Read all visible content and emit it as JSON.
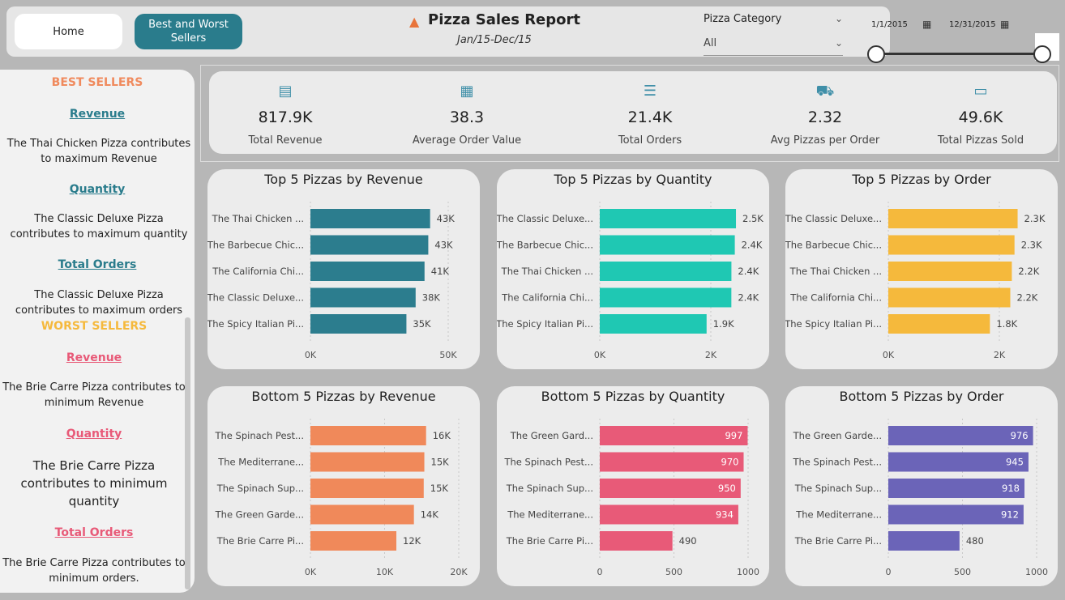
{
  "header": {
    "home_label": "Home",
    "bw_label": "Best and Worst Sellers",
    "title": "Pizza Sales Report",
    "subtitle": "Jan/15-Dec/15",
    "category_label": "Pizza Category",
    "category_value": "All",
    "date_start": "1/1/2015",
    "date_end": "12/31/2015"
  },
  "sidebar": {
    "best_heading": "BEST SELLERS",
    "best_revenue_link": "Revenue",
    "best_revenue_text": "The Thai Chicken Pizza contributes to maximum Revenue",
    "best_quantity_link": "Quantity",
    "best_quantity_text": "The Classic Deluxe Pizza contributes to maximum quantity",
    "best_orders_link": "Total Orders",
    "best_orders_text": "The Classic Deluxe Pizza contributes to maximum orders",
    "worst_heading": "WORST SELLERS",
    "worst_revenue_link": "Revenue",
    "worst_revenue_text": "The Brie Carre Pizza contributes to minimum Revenue",
    "worst_quantity_link": "Quantity",
    "worst_quantity_text": "The Brie Carre Pizza contributes to minimum quantity",
    "worst_orders_link": "Total Orders",
    "worst_orders_text": "The Brie Carre Pizza contributes to minimum orders."
  },
  "kpis": [
    {
      "value": "817.9K",
      "label": "Total Revenue",
      "icon": "money-icon"
    },
    {
      "value": "38.3",
      "label": "Average Order Value",
      "icon": "clipboard-icon"
    },
    {
      "value": "21.4K",
      "label": "Total Orders",
      "icon": "order-list-icon"
    },
    {
      "value": "2.32",
      "label": "Avg Pizzas per Order",
      "icon": "delivery-icon"
    },
    {
      "value": "49.6K",
      "label": "Total Pizzas Sold",
      "icon": "monitor-icon"
    }
  ],
  "colors": {
    "teal": "#2c7d8e",
    "aqua": "#1fc8b3",
    "yellow": "#f5b93c",
    "orange": "#f0895a",
    "pink": "#e85a78",
    "purple": "#6b64b8",
    "best_heading": "#f08a5d",
    "worst_heading": "#f5b93c",
    "best_link": "#2a7c8c",
    "worst_link": "#e85a78"
  },
  "chart_data": [
    {
      "type": "bar",
      "title": "Top 5 Pizzas by Revenue",
      "color": "#2c7d8e",
      "categories": [
        "The Thai Chicken ...",
        "The Barbecue Chic...",
        "The California Chi...",
        "The Classic Deluxe...",
        "The Spicy Italian Pi..."
      ],
      "values": [
        43434,
        42768,
        41410,
        38180,
        34831
      ],
      "labels": [
        "43K",
        "43K",
        "41K",
        "38K",
        "35K"
      ],
      "xlim": [
        0,
        50000
      ],
      "ticks": [
        "0K",
        "50K"
      ],
      "label_inside": false
    },
    {
      "type": "bar",
      "title": "Top 5 Pizzas by Quantity",
      "color": "#1fc8b3",
      "categories": [
        "The Classic Deluxe...",
        "The Barbecue Chic...",
        "The Thai Chicken ...",
        "The California Chi...",
        "The Spicy Italian Pi..."
      ],
      "values": [
        2453,
        2432,
        2371,
        2370,
        1924
      ],
      "labels": [
        "2.5K",
        "2.4K",
        "2.4K",
        "2.4K",
        "1.9K"
      ],
      "xlim": [
        0,
        2000
      ],
      "ticks": [
        "0K",
        "2K"
      ],
      "label_inside": false
    },
    {
      "type": "bar",
      "title": "Top 5 Pizzas by Order",
      "color": "#f5b93c",
      "categories": [
        "The Classic Deluxe...",
        "The Barbecue Chic...",
        "The Thai Chicken ...",
        "The California Chi...",
        "The Spicy Italian Pi..."
      ],
      "values": [
        2329,
        2273,
        2225,
        2197,
        1830
      ],
      "labels": [
        "2.3K",
        "2.3K",
        "2.2K",
        "2.2K",
        "1.8K"
      ],
      "xlim": [
        0,
        2000
      ],
      "ticks": [
        "0K",
        "2K"
      ],
      "label_inside": false
    },
    {
      "type": "bar",
      "title": "Bottom 5 Pizzas by Revenue",
      "color": "#f0895a",
      "categories": [
        "The Spinach Pest...",
        "The Mediterrane...",
        "The Spinach Sup...",
        "The Green Garde...",
        "The Brie Carre Pi..."
      ],
      "values": [
        15596,
        15360,
        15277,
        13955,
        11588
      ],
      "labels": [
        "16K",
        "15K",
        "15K",
        "14K",
        "12K"
      ],
      "xlim": [
        0,
        20000
      ],
      "ticks": [
        "0K",
        "10K",
        "20K"
      ],
      "label_inside": false
    },
    {
      "type": "bar",
      "title": "Bottom 5 Pizzas by Quantity",
      "color": "#e85a78",
      "categories": [
        "The Green Gard...",
        "The Spinach Pest...",
        "The Spinach Sup...",
        "The Mediterrane...",
        "The Brie Carre Pi..."
      ],
      "values": [
        997,
        970,
        950,
        934,
        490
      ],
      "labels": [
        "997",
        "970",
        "950",
        "934",
        "490"
      ],
      "xlim": [
        0,
        1000
      ],
      "ticks": [
        "0",
        "500",
        "1000"
      ],
      "label_inside": true
    },
    {
      "type": "bar",
      "title": "Bottom 5 Pizzas by Order",
      "color": "#6b64b8",
      "categories": [
        "The Green Garde...",
        "The Spinach Pest...",
        "The Spinach Sup...",
        "The Mediterrane...",
        "The Brie Carre Pi..."
      ],
      "values": [
        976,
        945,
        918,
        912,
        480
      ],
      "labels": [
        "976",
        "945",
        "918",
        "912",
        "480"
      ],
      "xlim": [
        0,
        1000
      ],
      "ticks": [
        "0",
        "500",
        "1000"
      ],
      "label_inside": true
    }
  ]
}
